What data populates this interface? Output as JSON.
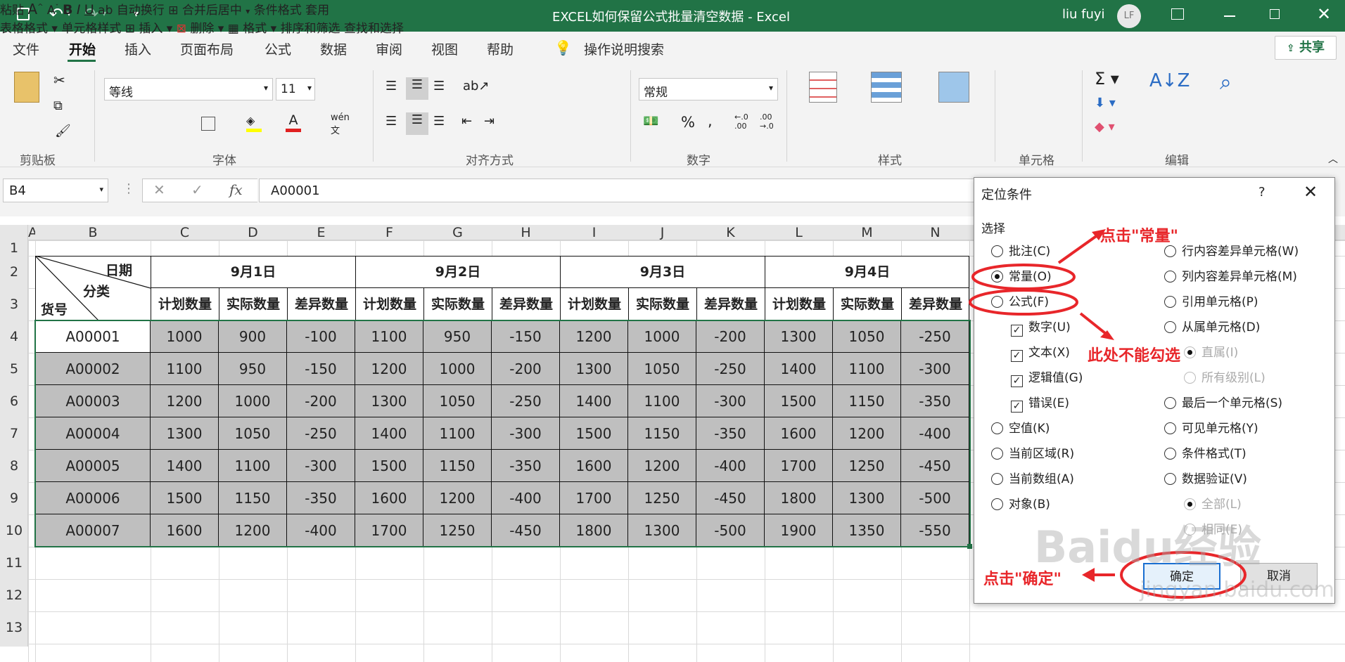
{
  "window": {
    "title": "EXCEL如何保留公式批量清空数据  -  Excel",
    "user": "liu fuyi",
    "avatar": "LF"
  },
  "tabs": [
    "文件",
    "开始",
    "插入",
    "页面布局",
    "公式",
    "数据",
    "审阅",
    "视图",
    "帮助"
  ],
  "search_label": "操作说明搜索",
  "share_label": "共享",
  "ribbon": {
    "paste": "粘贴",
    "font_name": "等线",
    "font_size": "11",
    "wrap_text": "自动换行",
    "merge_center": "合并后居中",
    "number_format": "常规",
    "cond_format": "条件格式",
    "table_format": "套用\n表格格式",
    "cell_styles": "单元格样式",
    "insert": "插入",
    "delete": "删除",
    "format": "格式",
    "sort_filter": "排序和筛选",
    "find_select": "查找和选择",
    "groups": [
      "剪贴板",
      "字体",
      "对齐方式",
      "数字",
      "样式",
      "单元格",
      "编辑"
    ]
  },
  "formula_bar": {
    "name_box": "B4",
    "fx": "fx",
    "value": "A00001"
  },
  "columns": [
    "A",
    "B",
    "C",
    "D",
    "E",
    "F",
    "G",
    "H",
    "I",
    "J",
    "K",
    "L",
    "M",
    "N"
  ],
  "rows": [
    "1",
    "2",
    "3",
    "4",
    "5",
    "6",
    "7",
    "8",
    "9",
    "10",
    "11",
    "12",
    "13"
  ],
  "sheet": {
    "corner": {
      "date": "日期",
      "category": "分类",
      "item": "货号"
    },
    "dates": [
      "9月1日",
      "9月2日",
      "9月3日",
      "9月4日"
    ],
    "subheaders": [
      "计划数量",
      "实际数量",
      "差异数量"
    ],
    "data": [
      [
        "A00001",
        "1000",
        "900",
        "-100",
        "1100",
        "950",
        "-150",
        "1200",
        "1000",
        "-200",
        "1300",
        "1050",
        "-250"
      ],
      [
        "A00002",
        "1100",
        "950",
        "-150",
        "1200",
        "1000",
        "-200",
        "1300",
        "1050",
        "-250",
        "1400",
        "1100",
        "-300"
      ],
      [
        "A00003",
        "1200",
        "1000",
        "-200",
        "1300",
        "1050",
        "-250",
        "1400",
        "1100",
        "-300",
        "1500",
        "1150",
        "-350"
      ],
      [
        "A00004",
        "1300",
        "1050",
        "-250",
        "1400",
        "1100",
        "-300",
        "1500",
        "1150",
        "-350",
        "1600",
        "1200",
        "-400"
      ],
      [
        "A00005",
        "1400",
        "1100",
        "-300",
        "1500",
        "1150",
        "-350",
        "1600",
        "1200",
        "-400",
        "1700",
        "1250",
        "-450"
      ],
      [
        "A00006",
        "1500",
        "1150",
        "-350",
        "1600",
        "1200",
        "-400",
        "1700",
        "1250",
        "-450",
        "1800",
        "1300",
        "-500"
      ],
      [
        "A00007",
        "1600",
        "1200",
        "-400",
        "1700",
        "1250",
        "-450",
        "1800",
        "1300",
        "-500",
        "1900",
        "1350",
        "-550"
      ]
    ]
  },
  "dialog": {
    "title": "定位条件",
    "help": "?",
    "section": "选择",
    "left_options": [
      "批注(C)",
      "常量(O)",
      "公式(F)"
    ],
    "sub_options": [
      "数字(U)",
      "文本(X)",
      "逻辑值(G)",
      "错误(E)"
    ],
    "left_options2": [
      "空值(K)",
      "当前区域(R)",
      "当前数组(A)",
      "对象(B)"
    ],
    "right_options": [
      "行内容差异单元格(W)",
      "列内容差异单元格(M)",
      "引用单元格(P)",
      "从属单元格(D)"
    ],
    "right_sub": [
      "直属(I)",
      "所有级别(L)"
    ],
    "right_options2": [
      "最后一个单元格(S)",
      "可见单元格(Y)",
      "条件格式(T)",
      "数据验证(V)"
    ],
    "right_sub2": [
      "全部(L)",
      "相同(E)"
    ],
    "ok": "确定",
    "cancel": "取消"
  },
  "annotations": {
    "click_constant": "点击\"常量\"",
    "no_check": "此处不能勾选",
    "click_ok": "点击\"确定\""
  },
  "watermark": "Baidu经验",
  "watermark_url": "jingyan.baidu.com",
  "colors": {
    "excel_green": "#217346",
    "annotation_red": "#e8262a",
    "cell_fill": "#bfbfbf"
  }
}
